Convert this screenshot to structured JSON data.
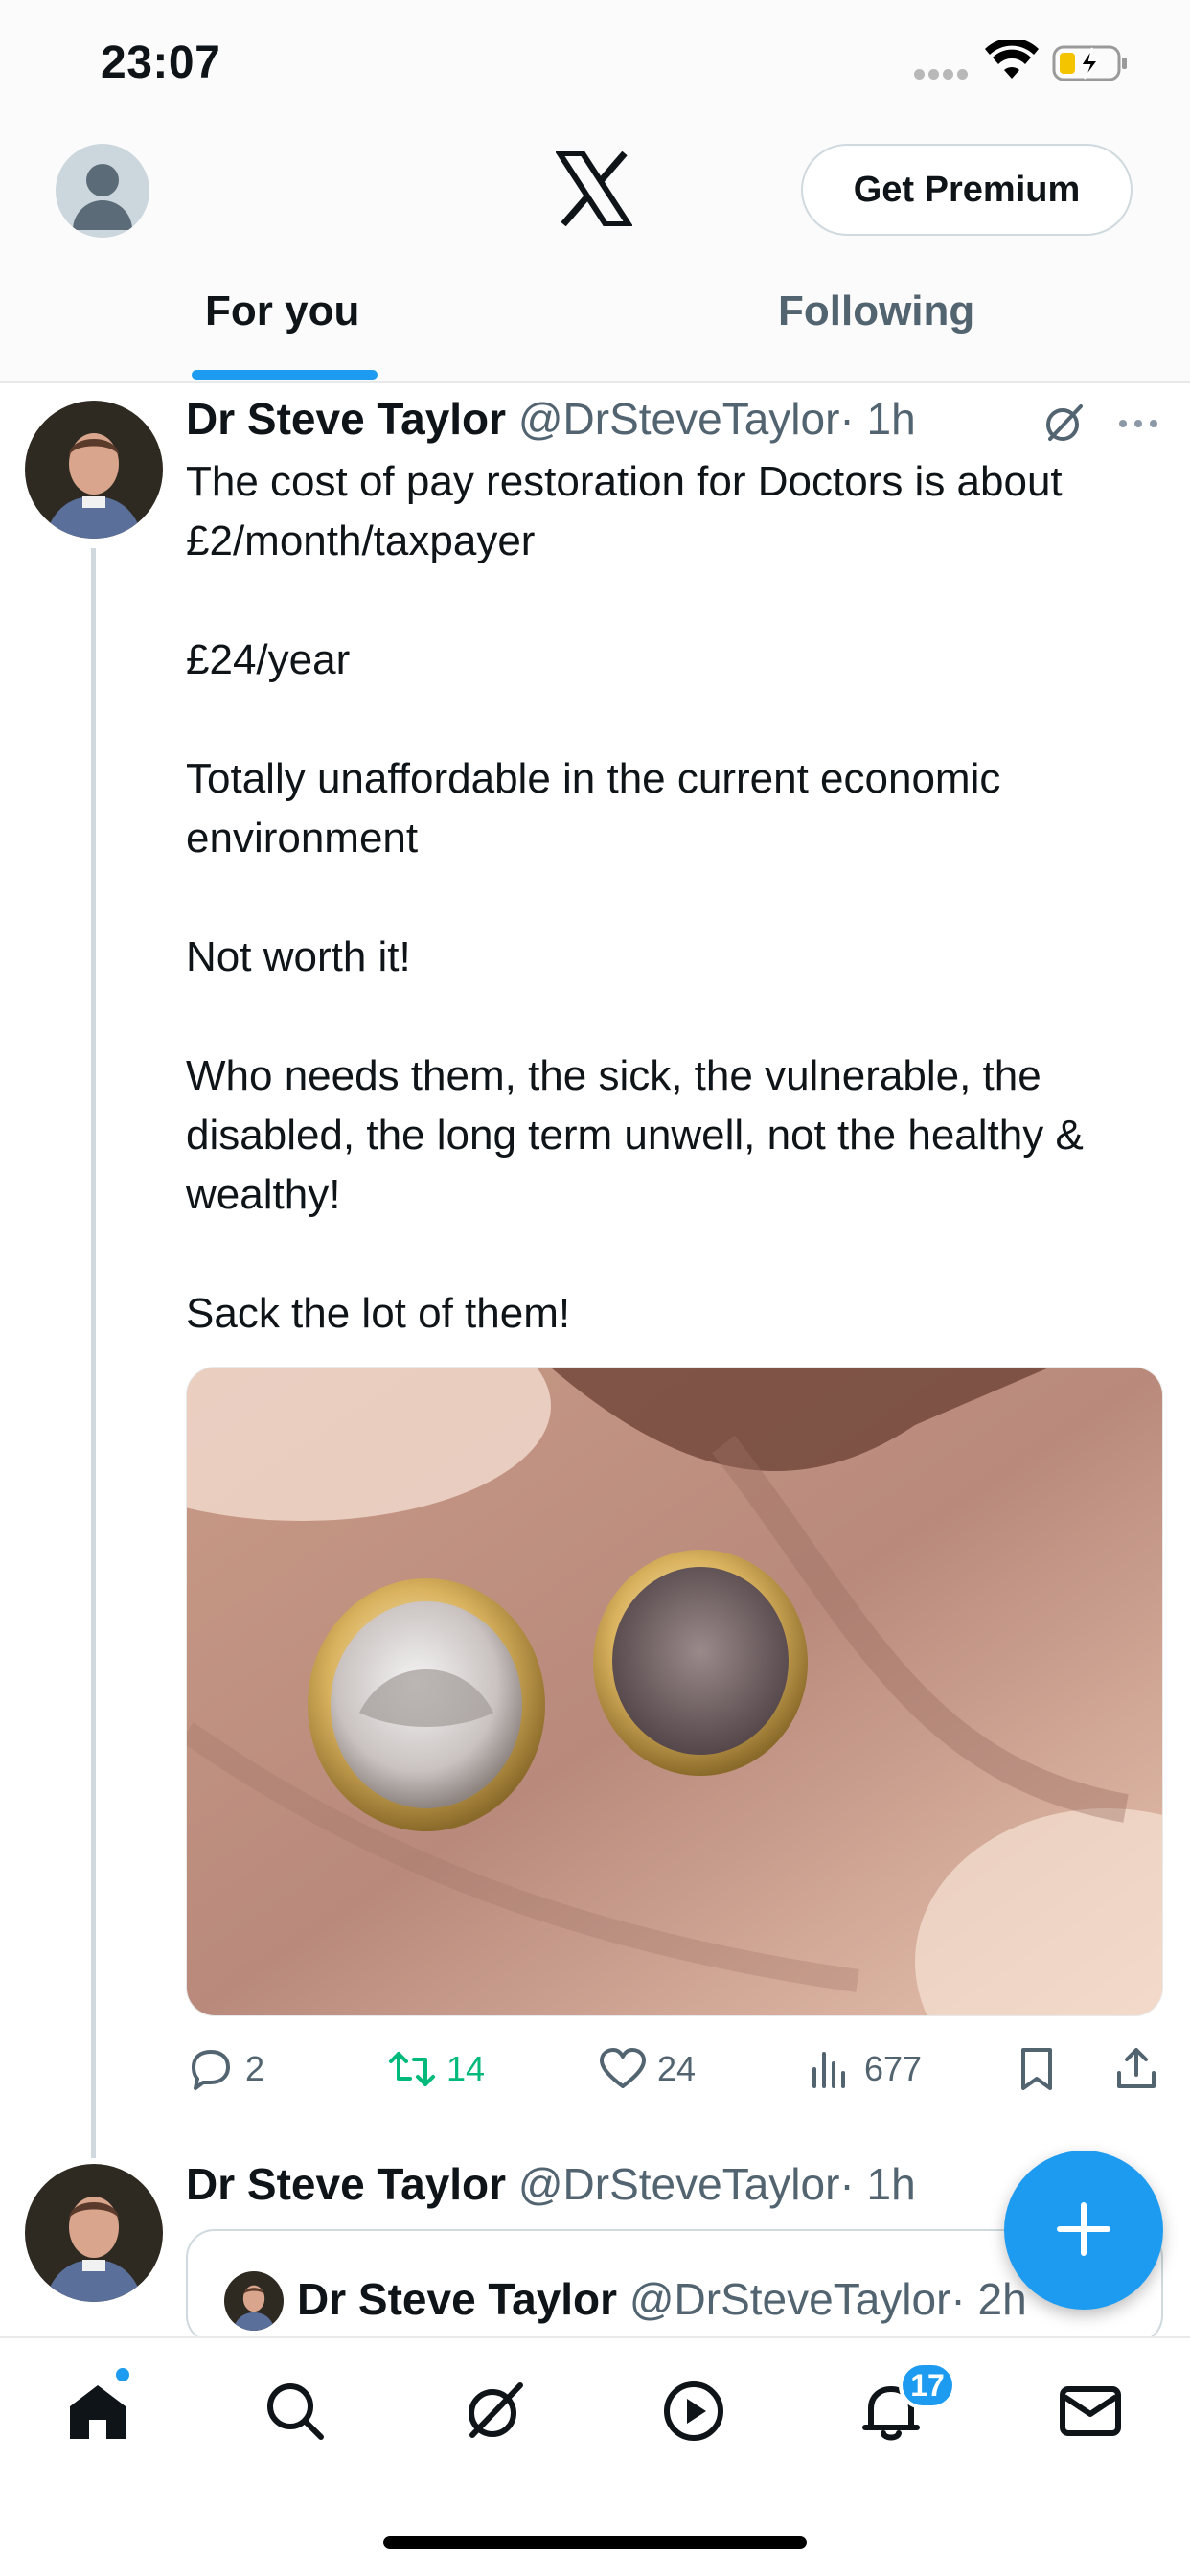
{
  "status_bar": {
    "time": "23:07"
  },
  "header": {
    "logo": "x-logo",
    "premium_label": "Get Premium",
    "tabs": [
      {
        "label": "For you",
        "active": true
      },
      {
        "label": "Following",
        "active": false
      }
    ]
  },
  "tweet": {
    "name": "Dr Steve Taylor",
    "handle": "@DrSteveTaylor",
    "time": "· 1h",
    "paragraphs": [
      "The cost of pay restoration for Doctors is about £2/month/taxpayer",
      "£24/year",
      "Totally unaffordable in the current economic environment",
      "Not worth it!",
      "Who needs them, the sick, the vulnerable, the disabled, the long term unwell, not the healthy & wealthy!",
      "Sack the lot of them!"
    ],
    "actions": {
      "replies": "2",
      "retweets": "14",
      "likes": "24",
      "views": "677"
    }
  },
  "tweet2": {
    "name": "Dr Steve Taylor",
    "handle": "@DrSteveTaylor",
    "time": "· 1h",
    "quote": {
      "name": "Dr Steve Taylor",
      "handle": "@DrSteveTaylor",
      "time": "· 2h"
    }
  },
  "bottom_nav": {
    "items": [
      "home-icon",
      "search-icon",
      "grok-icon",
      "video-icon",
      "notifications-icon",
      "messages-icon"
    ],
    "notification_count": "17"
  },
  "colors": {
    "accent": "#1d9bf0",
    "retweet_green": "#00ba7c",
    "secondary_text": "#536471"
  }
}
